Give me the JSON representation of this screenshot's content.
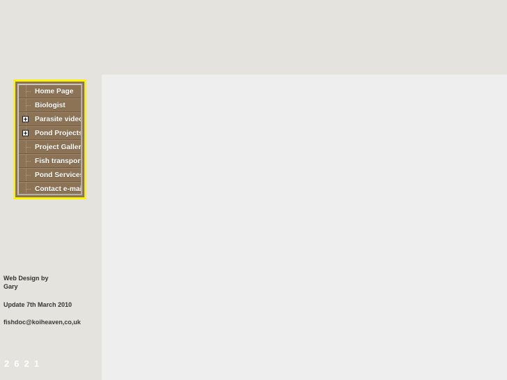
{
  "page": {
    "background_color": "#eeeeee",
    "sidebar_background_color": "#e4e3dd",
    "content_background_color": "#eeeeee"
  },
  "nav": {
    "border_color": "#fbf400",
    "button_color": "#8d7355",
    "text_color": "#ffffff",
    "items": [
      {
        "label": "Home Page",
        "has_toggle": false,
        "toggle_icon": ""
      },
      {
        "label": "Biologist",
        "has_toggle": false,
        "toggle_icon": ""
      },
      {
        "label": "Parasite videos",
        "has_toggle": true,
        "toggle_icon": "plus-box-icon"
      },
      {
        "label": "Pond Projects",
        "has_toggle": true,
        "toggle_icon": "plus-box-icon"
      },
      {
        "label": "Project Gallery",
        "has_toggle": false,
        "toggle_icon": ""
      },
      {
        "label": "Fish transport",
        "has_toggle": false,
        "toggle_icon": ""
      },
      {
        "label": "Pond Services",
        "has_toggle": false,
        "toggle_icon": ""
      },
      {
        "label": "Contact e-mail",
        "has_toggle": false,
        "toggle_icon": ""
      }
    ]
  },
  "credits": {
    "designer_line1": "Web Design by",
    "designer_line2": "Gary",
    "update": "Update 7th March 2010",
    "email": "fishdoc@koiheaven,co,uk"
  },
  "counter": {
    "digits": [
      "2",
      "6",
      "2",
      "1"
    ],
    "value": "2621",
    "color": "#ffffff"
  }
}
